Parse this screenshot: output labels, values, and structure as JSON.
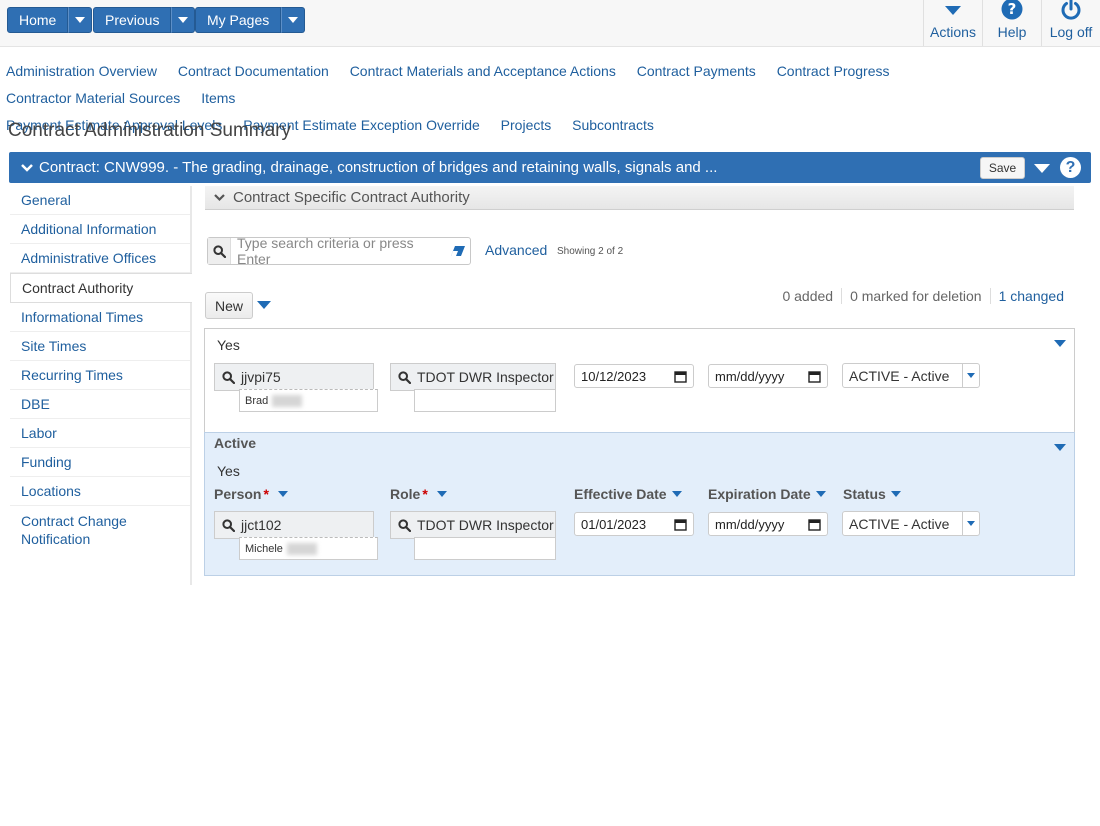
{
  "topnav": {
    "home": "Home",
    "previous": "Previous",
    "my_pages": "My Pages",
    "actions": "Actions",
    "help": "Help",
    "logoff": "Log off"
  },
  "links": [
    "Administration Overview",
    "Contract Documentation",
    "Contract Materials and Acceptance Actions",
    "Contract Payments",
    "Contract Progress",
    "Contractor Material Sources",
    "Items",
    "Payment Estimate Approval Levels",
    "Payment Estimate Exception Override",
    "Projects",
    "Subcontracts"
  ],
  "page_title": "Contract Administration Summary",
  "contract_bar": {
    "title": "Contract: CNW999. - The grading, drainage, construction of bridges and retaining walls, signals and ...",
    "save": "Save"
  },
  "sidebar": [
    "General",
    "Additional Information",
    "Administrative Offices",
    "Contract Authority",
    "Informational Times",
    "Site Times",
    "Recurring Times",
    "DBE",
    "Labor",
    "Funding",
    "Locations",
    "Contract Change Notification"
  ],
  "section": {
    "title": "Contract Specific Contract Authority",
    "search_placeholder": "Type search criteria or press Enter",
    "advanced": "Advanced",
    "showing": "Showing 2 of 2",
    "new": "New",
    "added": "0 added",
    "marked": "0 marked for deletion",
    "changed": "1 changed"
  },
  "columns": {
    "person": "Person",
    "role": "Role",
    "effective": "Effective Date",
    "expiration": "Expiration Date",
    "status": "Status"
  },
  "rows": [
    {
      "active_label": "",
      "active_value": "Yes",
      "person_id": "jjvpi75",
      "person_name": "Brad",
      "role": "TDOT DWR Inspector",
      "effective": "10/12/2023",
      "expiration": "mm/dd/yyyy",
      "status": "ACTIVE - Active"
    },
    {
      "active_label": "Active",
      "active_value": "Yes",
      "person_id": "jjct102",
      "person_name": "Michele",
      "role": "TDOT DWR Inspector",
      "effective": "01/01/2023",
      "expiration": "mm/dd/yyyy",
      "status": "ACTIVE - Active"
    }
  ],
  "colors": {
    "primary": "#2f6fb3",
    "link": "#1f5f9e",
    "selected_row": "#e3eefa"
  }
}
